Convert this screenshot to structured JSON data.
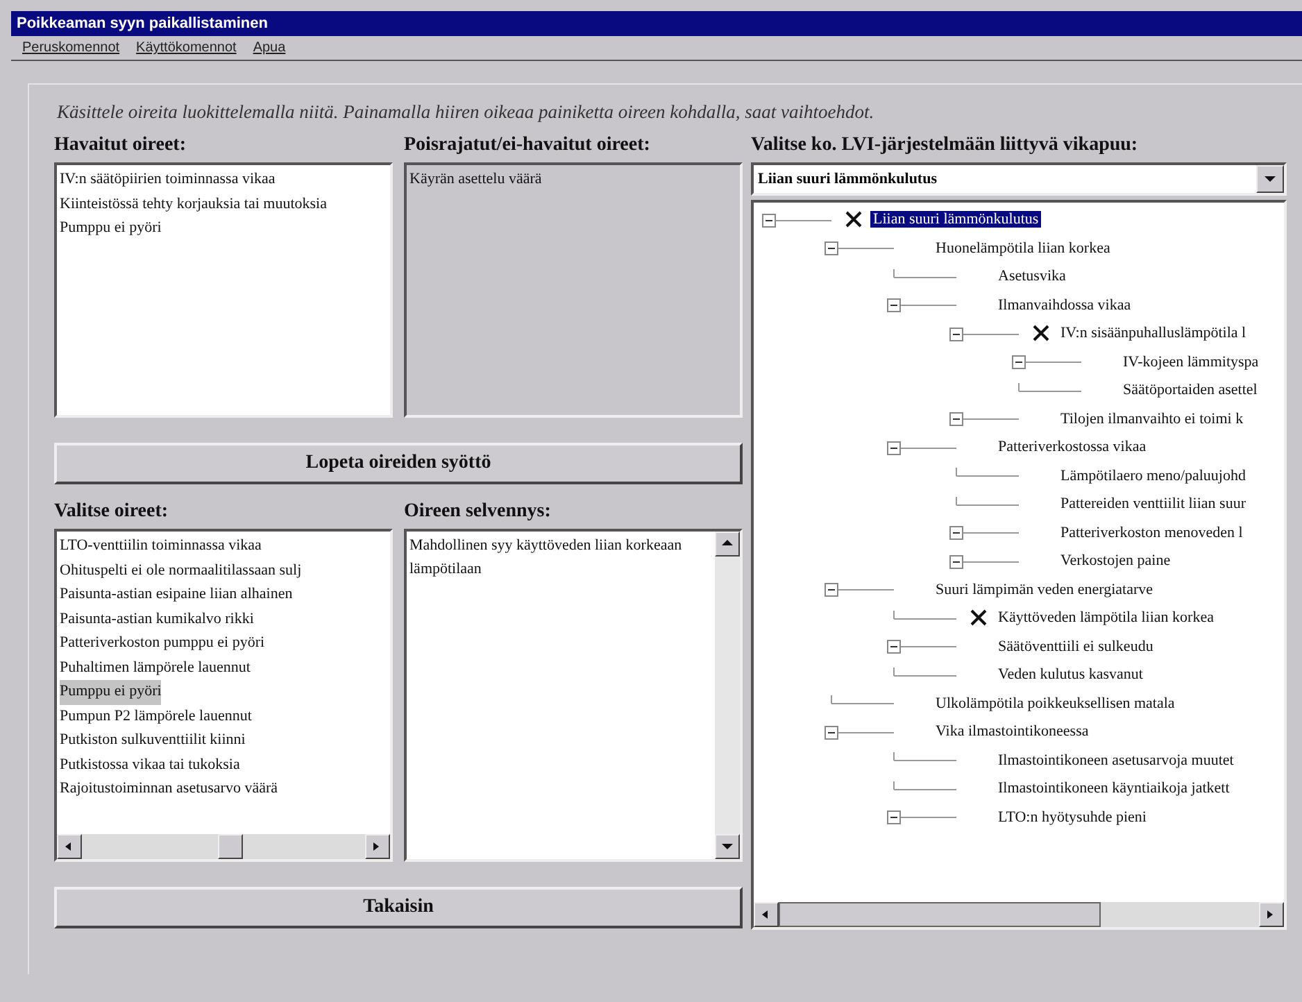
{
  "window": {
    "title": "Poikkeaman syyn paikallistaminen"
  },
  "menu": [
    "Peruskomennot",
    "Käyttökomennot",
    "Apua"
  ],
  "instruction": "Käsittele oireita luokittelemalla niitä. Painamalla hiiren oikeaa painiketta oireen kohdalla, saat vaihtoehdot.",
  "observed": {
    "label": "Havaitut oireet:",
    "items": [
      "IV:n säätöpiirien toiminnassa vikaa",
      "Kiinteistössä tehty korjauksia tai muutoksia",
      "Pumppu ei pyöri"
    ]
  },
  "excluded": {
    "label": "Poisrajatut/ei-havaitut oireet:",
    "items": [
      "Käyrän asettelu väärä"
    ]
  },
  "stop_button": "Lopeta oireiden syöttö",
  "choose": {
    "label": "Valitse oireet:",
    "items": [
      {
        "text": "LTO-venttiilin toiminnassa vikaa",
        "selected": false
      },
      {
        "text": "Ohituspelti ei ole normaalitilassaan sulj",
        "selected": false
      },
      {
        "text": "Paisunta-astian esipaine liian alhainen",
        "selected": false
      },
      {
        "text": "Paisunta-astian kumikalvo rikki",
        "selected": false
      },
      {
        "text": "Patteriverkoston pumppu ei pyöri",
        "selected": false
      },
      {
        "text": "Puhaltimen lämpörele lauennut",
        "selected": false
      },
      {
        "text": "Pumppu ei pyöri",
        "selected": true
      },
      {
        "text": "Pumpun P2 lämpörele lauennut",
        "selected": false
      },
      {
        "text": "Putkiston sulkuventtiilit kiinni",
        "selected": false
      },
      {
        "text": "Putkistossa vikaa tai tukoksia",
        "selected": false
      },
      {
        "text": "Rajoitustoiminnan asetusarvo väärä",
        "selected": false
      }
    ]
  },
  "explanation": {
    "label": "Oireen selvennys:",
    "text": "Mahdollinen syy käyttöveden liian korkeaan lämpötilaan"
  },
  "back_button": "Takaisin",
  "fault_tree": {
    "label": "Valitse ko. LVI-järjestelmään liittyvä vikapuu:",
    "value": "Liian suuri lämmönkulutus",
    "nodes": [
      {
        "text": "Liian suuri lämmönkulutus",
        "kind": "folder",
        "marked": true,
        "selected": true,
        "children": [
          {
            "text": "Huonelämpötila liian korkea",
            "kind": "folder",
            "marked": false,
            "selected": false,
            "children": [
              {
                "text": "Asetusvika",
                "kind": "leaf",
                "marked": false,
                "selected": false
              },
              {
                "text": "Ilmanvaihdossa vikaa",
                "kind": "folder",
                "marked": false,
                "selected": false,
                "children": [
                  {
                    "text": "IV:n sisäänpuhalluslämpötila l",
                    "kind": "folder",
                    "marked": true,
                    "selected": false,
                    "children": [
                      {
                        "text": "IV-kojeen lämmityspa",
                        "kind": "folder",
                        "marked": false,
                        "selected": false
                      },
                      {
                        "text": "Säätöportaiden asettel",
                        "kind": "leaf",
                        "marked": false,
                        "selected": false
                      }
                    ]
                  },
                  {
                    "text": "Tilojen ilmanvaihto ei toimi k",
                    "kind": "folder",
                    "marked": false,
                    "selected": false
                  }
                ]
              },
              {
                "text": "Patteriverkostossa vikaa",
                "kind": "folder",
                "marked": false,
                "selected": false,
                "children": [
                  {
                    "text": "Lämpötilaero meno/paluujohd",
                    "kind": "leaf",
                    "marked": false,
                    "selected": false
                  },
                  {
                    "text": "Pattereiden venttiilit liian suur",
                    "kind": "leaf",
                    "marked": false,
                    "selected": false
                  },
                  {
                    "text": "Patteriverkoston menoveden l",
                    "kind": "folder",
                    "marked": false,
                    "selected": false
                  },
                  {
                    "text": "Verkostojen paine",
                    "kind": "folder",
                    "marked": false,
                    "selected": false
                  }
                ]
              }
            ]
          },
          {
            "text": "Suuri lämpimän veden energiatarve",
            "kind": "folder",
            "marked": false,
            "selected": false,
            "children": [
              {
                "text": "Käyttöveden lämpötila liian korkea",
                "kind": "leaf",
                "marked": true,
                "selected": false
              },
              {
                "text": "Säätöventtiili ei sulkeudu",
                "kind": "folder",
                "marked": false,
                "selected": false
              },
              {
                "text": "Veden kulutus kasvanut",
                "kind": "leaf",
                "marked": false,
                "selected": false
              }
            ]
          },
          {
            "text": "Ulkolämpötila poikkeuksellisen matala",
            "kind": "leaf",
            "marked": false,
            "selected": false
          },
          {
            "text": "Vika ilmastointikoneessa",
            "kind": "folder",
            "marked": false,
            "selected": false,
            "children": [
              {
                "text": "Ilmastointikoneen asetusarvoja muutet",
                "kind": "leaf",
                "marked": false,
                "selected": false
              },
              {
                "text": "Ilmastointikoneen käyntiaikoja jatkett",
                "kind": "leaf",
                "marked": false,
                "selected": false
              },
              {
                "text": "LTO:n hyötysuhde pieni",
                "kind": "folder",
                "marked": false,
                "selected": false
              }
            ]
          }
        ]
      }
    ]
  }
}
